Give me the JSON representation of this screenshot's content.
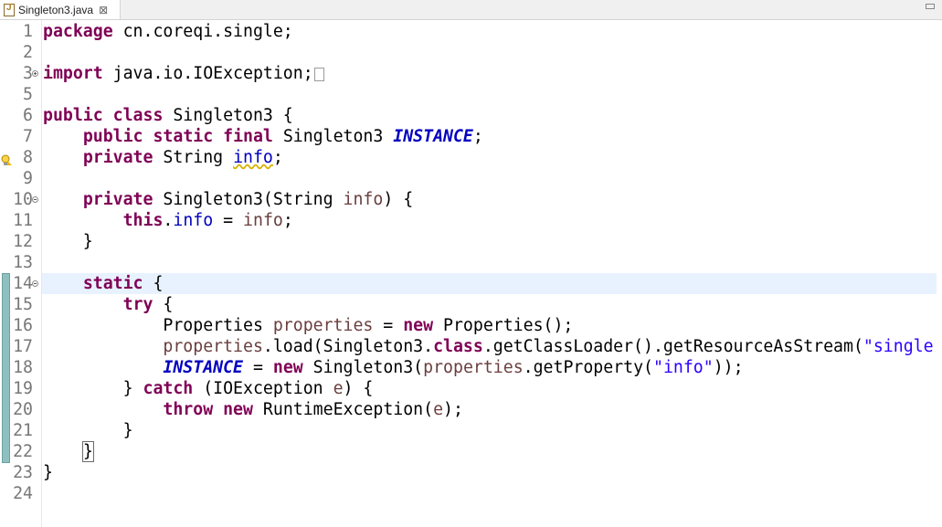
{
  "tab": {
    "filename": "Singleton3.java",
    "close_glyph": "⊠"
  },
  "editor": {
    "current_line": 14,
    "lines": [
      {
        "n": "1",
        "tokens": [
          {
            "t": "package",
            "c": "kw"
          },
          {
            "t": " cn.coreqi.single;",
            "c": ""
          }
        ]
      },
      {
        "n": "2",
        "tokens": []
      },
      {
        "n": "3",
        "fold": "plus",
        "tokens": [
          {
            "t": "import",
            "c": "kw"
          },
          {
            "t": " java.io.IOException;",
            "c": ""
          }
        ],
        "collapsed": true
      },
      {
        "n": "5",
        "tokens": []
      },
      {
        "n": "6",
        "tokens": [
          {
            "t": "public",
            "c": "kw"
          },
          {
            "t": " ",
            "c": ""
          },
          {
            "t": "class",
            "c": "kw"
          },
          {
            "t": " Singleton3 {",
            "c": ""
          }
        ]
      },
      {
        "n": "7",
        "tokens": [
          {
            "t": "    ",
            "c": ""
          },
          {
            "t": "public",
            "c": "kw"
          },
          {
            "t": " ",
            "c": ""
          },
          {
            "t": "static",
            "c": "kw"
          },
          {
            "t": " ",
            "c": ""
          },
          {
            "t": "final",
            "c": "kw"
          },
          {
            "t": " Singleton3 ",
            "c": ""
          },
          {
            "t": "INSTANCE",
            "c": "sfield"
          },
          {
            "t": ";",
            "c": ""
          }
        ]
      },
      {
        "n": "8",
        "warn": true,
        "tokens": [
          {
            "t": "    ",
            "c": ""
          },
          {
            "t": "private",
            "c": "kw"
          },
          {
            "t": " String ",
            "c": ""
          },
          {
            "t": "info",
            "c": "field squiggle"
          },
          {
            "t": ";",
            "c": ""
          }
        ]
      },
      {
        "n": "9",
        "tokens": []
      },
      {
        "n": "10",
        "fold": "minus",
        "tokens": [
          {
            "t": "    ",
            "c": ""
          },
          {
            "t": "private",
            "c": "kw"
          },
          {
            "t": " Singleton3(String ",
            "c": ""
          },
          {
            "t": "info",
            "c": "param"
          },
          {
            "t": ") {",
            "c": ""
          }
        ]
      },
      {
        "n": "11",
        "tokens": [
          {
            "t": "        ",
            "c": ""
          },
          {
            "t": "this",
            "c": "kw"
          },
          {
            "t": ".",
            "c": ""
          },
          {
            "t": "info",
            "c": "field"
          },
          {
            "t": " = ",
            "c": ""
          },
          {
            "t": "info",
            "c": "param"
          },
          {
            "t": ";",
            "c": ""
          }
        ]
      },
      {
        "n": "12",
        "tokens": [
          {
            "t": "    }",
            "c": ""
          }
        ]
      },
      {
        "n": "13",
        "tokens": []
      },
      {
        "n": "14",
        "fold": "minus",
        "tokens": [
          {
            "t": "    ",
            "c": ""
          },
          {
            "t": "static",
            "c": "kw"
          },
          {
            "t": " {",
            "c": ""
          }
        ]
      },
      {
        "n": "15",
        "tokens": [
          {
            "t": "        ",
            "c": ""
          },
          {
            "t": "try",
            "c": "kw"
          },
          {
            "t": " {",
            "c": ""
          }
        ]
      },
      {
        "n": "16",
        "tokens": [
          {
            "t": "            Properties ",
            "c": ""
          },
          {
            "t": "properties",
            "c": "local"
          },
          {
            "t": " = ",
            "c": ""
          },
          {
            "t": "new",
            "c": "kw"
          },
          {
            "t": " Properties();",
            "c": ""
          }
        ]
      },
      {
        "n": "17",
        "tokens": [
          {
            "t": "            ",
            "c": ""
          },
          {
            "t": "properties",
            "c": "local"
          },
          {
            "t": ".load(Singleton3.",
            "c": ""
          },
          {
            "t": "class",
            "c": "kw"
          },
          {
            "t": ".getClassLoader().getResourceAsStream(",
            "c": ""
          },
          {
            "t": "\"single",
            "c": "str"
          }
        ]
      },
      {
        "n": "18",
        "tokens": [
          {
            "t": "            ",
            "c": ""
          },
          {
            "t": "INSTANCE",
            "c": "sfield"
          },
          {
            "t": " = ",
            "c": ""
          },
          {
            "t": "new",
            "c": "kw"
          },
          {
            "t": " Singleton3(",
            "c": ""
          },
          {
            "t": "properties",
            "c": "local"
          },
          {
            "t": ".getProperty(",
            "c": ""
          },
          {
            "t": "\"info\"",
            "c": "str"
          },
          {
            "t": "));",
            "c": ""
          }
        ]
      },
      {
        "n": "19",
        "tokens": [
          {
            "t": "        } ",
            "c": ""
          },
          {
            "t": "catch",
            "c": "kw"
          },
          {
            "t": " (IOException ",
            "c": ""
          },
          {
            "t": "e",
            "c": "param"
          },
          {
            "t": ") {",
            "c": ""
          }
        ]
      },
      {
        "n": "20",
        "tokens": [
          {
            "t": "            ",
            "c": ""
          },
          {
            "t": "throw",
            "c": "kw"
          },
          {
            "t": " ",
            "c": ""
          },
          {
            "t": "new",
            "c": "kw"
          },
          {
            "t": " RuntimeException(",
            "c": ""
          },
          {
            "t": "e",
            "c": "param"
          },
          {
            "t": ");",
            "c": ""
          }
        ]
      },
      {
        "n": "21",
        "tokens": [
          {
            "t": "        }",
            "c": ""
          }
        ]
      },
      {
        "n": "22",
        "tokens": [
          {
            "t": "    ",
            "c": ""
          },
          {
            "t": "}",
            "c": "brace-box"
          }
        ]
      },
      {
        "n": "23",
        "tokens": [
          {
            "t": "}",
            "c": ""
          }
        ]
      },
      {
        "n": "24",
        "tokens": []
      }
    ]
  }
}
